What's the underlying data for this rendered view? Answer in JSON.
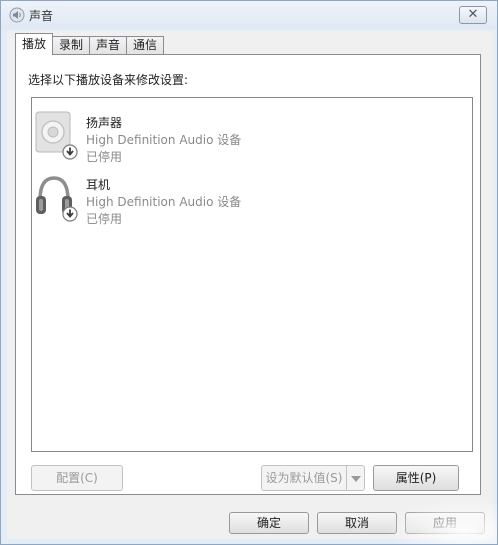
{
  "window": {
    "title": "声音",
    "close_glyph": "✕"
  },
  "tabs": [
    {
      "label": "播放",
      "active": true
    },
    {
      "label": "录制",
      "active": false
    },
    {
      "label": "声音",
      "active": false
    },
    {
      "label": "通信",
      "active": false
    }
  ],
  "panel": {
    "instruction": "选择以下播放设备来修改设置:"
  },
  "devices": [
    {
      "name": "扬声器",
      "description": "High Definition Audio 设备",
      "status": "已停用",
      "icon": "speaker-icon",
      "overlay_icon": "disabled-arrow-icon"
    },
    {
      "name": "耳机",
      "description": "High Definition Audio 设备",
      "status": "已停用",
      "icon": "headphones-icon",
      "overlay_icon": "disabled-arrow-icon"
    }
  ],
  "buttons": {
    "configure": "配置(C)",
    "set_default": "设为默认值(S)",
    "properties": "属性(P)",
    "ok": "确定",
    "cancel": "取消",
    "apply": "应用"
  },
  "colors": {
    "window_frame": "#8fa6c3",
    "disabled_text": "#8a8a8a"
  }
}
